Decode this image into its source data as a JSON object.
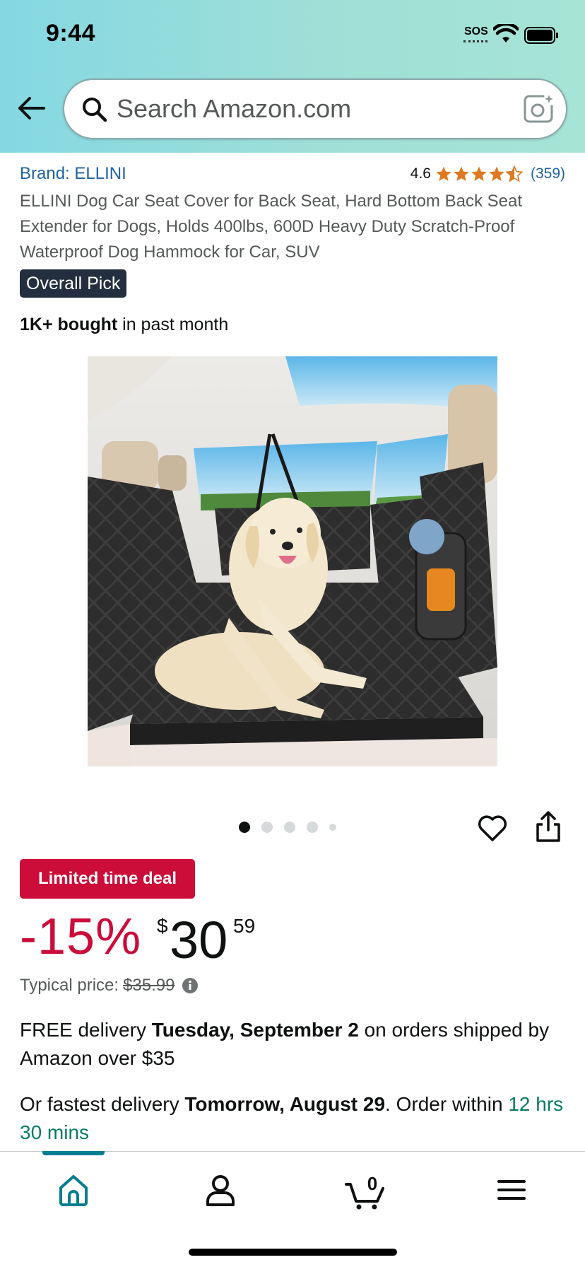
{
  "status_bar": {
    "time": "9:44",
    "sos": "SOS"
  },
  "search": {
    "placeholder": "Search Amazon.com",
    "value": ""
  },
  "icons": {
    "back": "arrow-left-icon",
    "search": "search-icon",
    "camera": "camera-lens-icon",
    "heart": "heart-icon",
    "share": "share-icon",
    "info": "info-icon",
    "home": "home-icon",
    "account": "person-icon",
    "cart": "cart-icon",
    "menu": "hamburger-menu-icon"
  },
  "product": {
    "brand": "Brand: ELLINI",
    "rating": "4.6",
    "rating_value": 4.6,
    "review_count": "(359)",
    "title": "ELLINI Dog Car Seat Cover for Back Seat, Hard Bottom Back Seat Extender for Dogs, Holds 400lbs, 600D Heavy Duty Scratch-Proof Waterproof Dog Hammock for Car, SUV",
    "badge": "Overall Pick",
    "bought_bold": "1K+ bought",
    "bought_rest": " in past month",
    "image_count": 5,
    "image_index": 1
  },
  "deal": {
    "badge": "Limited time deal",
    "discount": "-15%",
    "currency": "$",
    "price_whole": "30",
    "price_fraction": "59",
    "typical_label": "Typical price:",
    "typical_price": "$35.99"
  },
  "delivery": {
    "prefix": "FREE delivery ",
    "date": "Tuesday, September 2",
    "suffix": " on orders shipped by Amazon over $35",
    "fast_prefix": "Or fastest delivery ",
    "fast_date": "Tomorrow, August 29",
    "fast_suffix": ". Order within ",
    "countdown": "12 hrs 30 mins"
  },
  "tabbar": {
    "cart_count": "0",
    "active": "home"
  },
  "colors": {
    "header_gradient_start": "#84d8e3",
    "header_gradient_end": "#a6e4d5",
    "link": "#2162a1",
    "star": "#de7921",
    "deal_red": "#cc0c39",
    "badge_dark": "#232f3e",
    "countdown_green": "#067d62",
    "tab_active": "#037e91"
  }
}
